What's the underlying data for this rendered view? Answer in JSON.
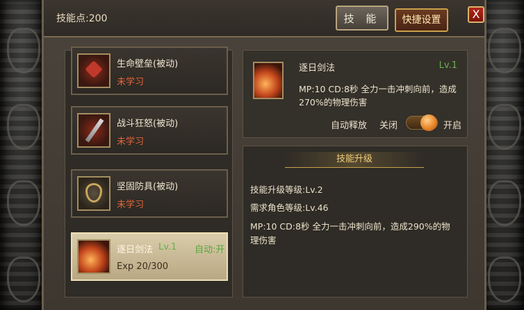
{
  "header": {
    "skill_points": "技能点:200",
    "tab_skill": "技 能",
    "tab_quick_settings": "快捷设置",
    "close_symbol": "X"
  },
  "skill_list": [
    {
      "name": "生命壁垒(被动)",
      "status": "未学习",
      "icon": "heart-icon"
    },
    {
      "name": "战斗狂怒(被动)",
      "status": "未学习",
      "icon": "sword-icon"
    },
    {
      "name": "坚固防具(被动)",
      "status": "未学习",
      "icon": "shield-icon"
    },
    {
      "name": "逐日剑法",
      "level": "Lv.1",
      "auto": "自动:开",
      "exp": "Exp 20/300",
      "icon": "flame-sword-icon"
    }
  ],
  "detail": {
    "name": "逐日剑法",
    "level": "Lv.1",
    "description": "MP:10  CD:8秒  全力一击冲刺向前，造成270%的物理伤害",
    "auto_cast_label": "自动释放",
    "off_label": "关闭",
    "on_label": "开启",
    "toggle_state": "on"
  },
  "upgrade": {
    "title": "技能升级",
    "skill_level": "技能升级等级:Lv.2",
    "required_level": "需求角色等级:Lv.46",
    "description": "MP:10  CD:8秒  全力一击冲刺向前，造成290%的物理伤害"
  },
  "colors": {
    "accent_gold": "#c6a24c",
    "status_red": "#e2643a",
    "level_green": "#66b24a"
  }
}
